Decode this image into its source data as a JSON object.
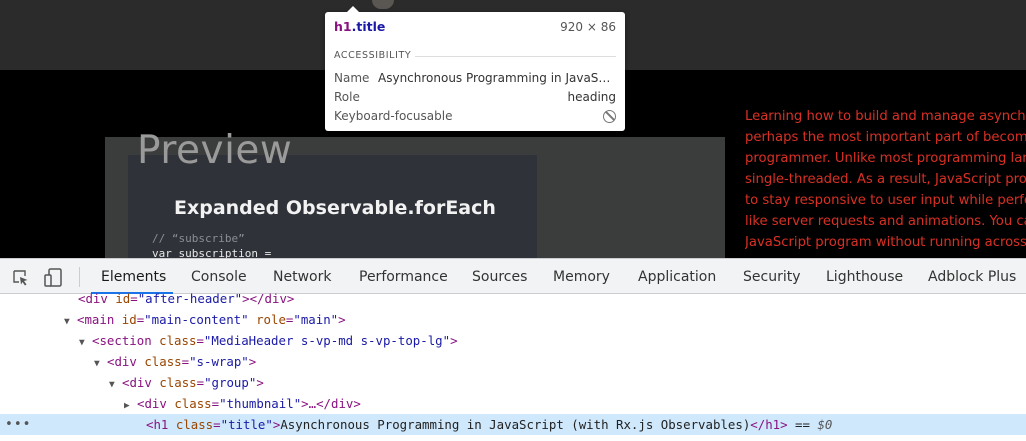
{
  "viewport": {
    "preview_label": "Preview",
    "slide_heading": "Expanded Observable.forEach",
    "slide_comment": "// “subscribe”",
    "slide_code": "var subscription =",
    "description_lines": [
      "Learning how to build and manage asynchronous",
      "perhaps the most important part of becoming",
      "programmer. Unlike most programming langua",
      "single-threaded. As a result, JavaScript progr",
      "to stay responsive to user input while perform",
      "like server requests and animations. You can",
      "JavaScript program without running across a"
    ],
    "description_color": "#d93025"
  },
  "tooltip": {
    "element_tag": "h1",
    "element_class": ".title",
    "size": "920 × 86",
    "section_label": "ACCESSIBILITY",
    "name_label": "Name",
    "name_value": "Asynchronous Programming in JavaScript (with Rx.js Observables)",
    "role_label": "Role",
    "role_value": "heading",
    "focus_label": "Keyboard-focusable",
    "focus_icon": "not-allowed-icon"
  },
  "devtools": {
    "tabs": [
      "Elements",
      "Console",
      "Network",
      "Performance",
      "Sources",
      "Memory",
      "Application",
      "Security",
      "Lighthouse",
      "Adblock Plus"
    ],
    "active_tab": "Elements",
    "accent_color": "#1a73e8",
    "dom": {
      "line0": {
        "open": "<div ",
        "attr": "id",
        "val": "\"after-header\"",
        "close": "></div>"
      },
      "line1": {
        "open": "<main ",
        "attr1": "id",
        "val1": "\"main-content\"",
        "attr2": "role",
        "val2": "\"main\"",
        "close": ">"
      },
      "line2": {
        "open": "<section ",
        "attr": "class",
        "val": "\"MediaHeader s-vp-md s-vp-top-lg\"",
        "close": ">"
      },
      "line3": {
        "open": "<div ",
        "attr": "class",
        "val": "\"s-wrap\"",
        "close": ">"
      },
      "line4": {
        "open": "<div ",
        "attr": "class",
        "val": "\"group\"",
        "close": ">"
      },
      "line5": {
        "open": "<div ",
        "attr": "class",
        "val": "\"thumbnail\"",
        "close": ">…</div>"
      },
      "line6": {
        "open": "<h1 ",
        "attr": "class",
        "val": "\"title\"",
        "gt": ">",
        "text": "Asynchronous Programming in JavaScript (with Rx.js Observables)",
        "close": "</h1>",
        "eq": " == ",
        "ref": "$0"
      },
      "dots": "•••"
    }
  }
}
